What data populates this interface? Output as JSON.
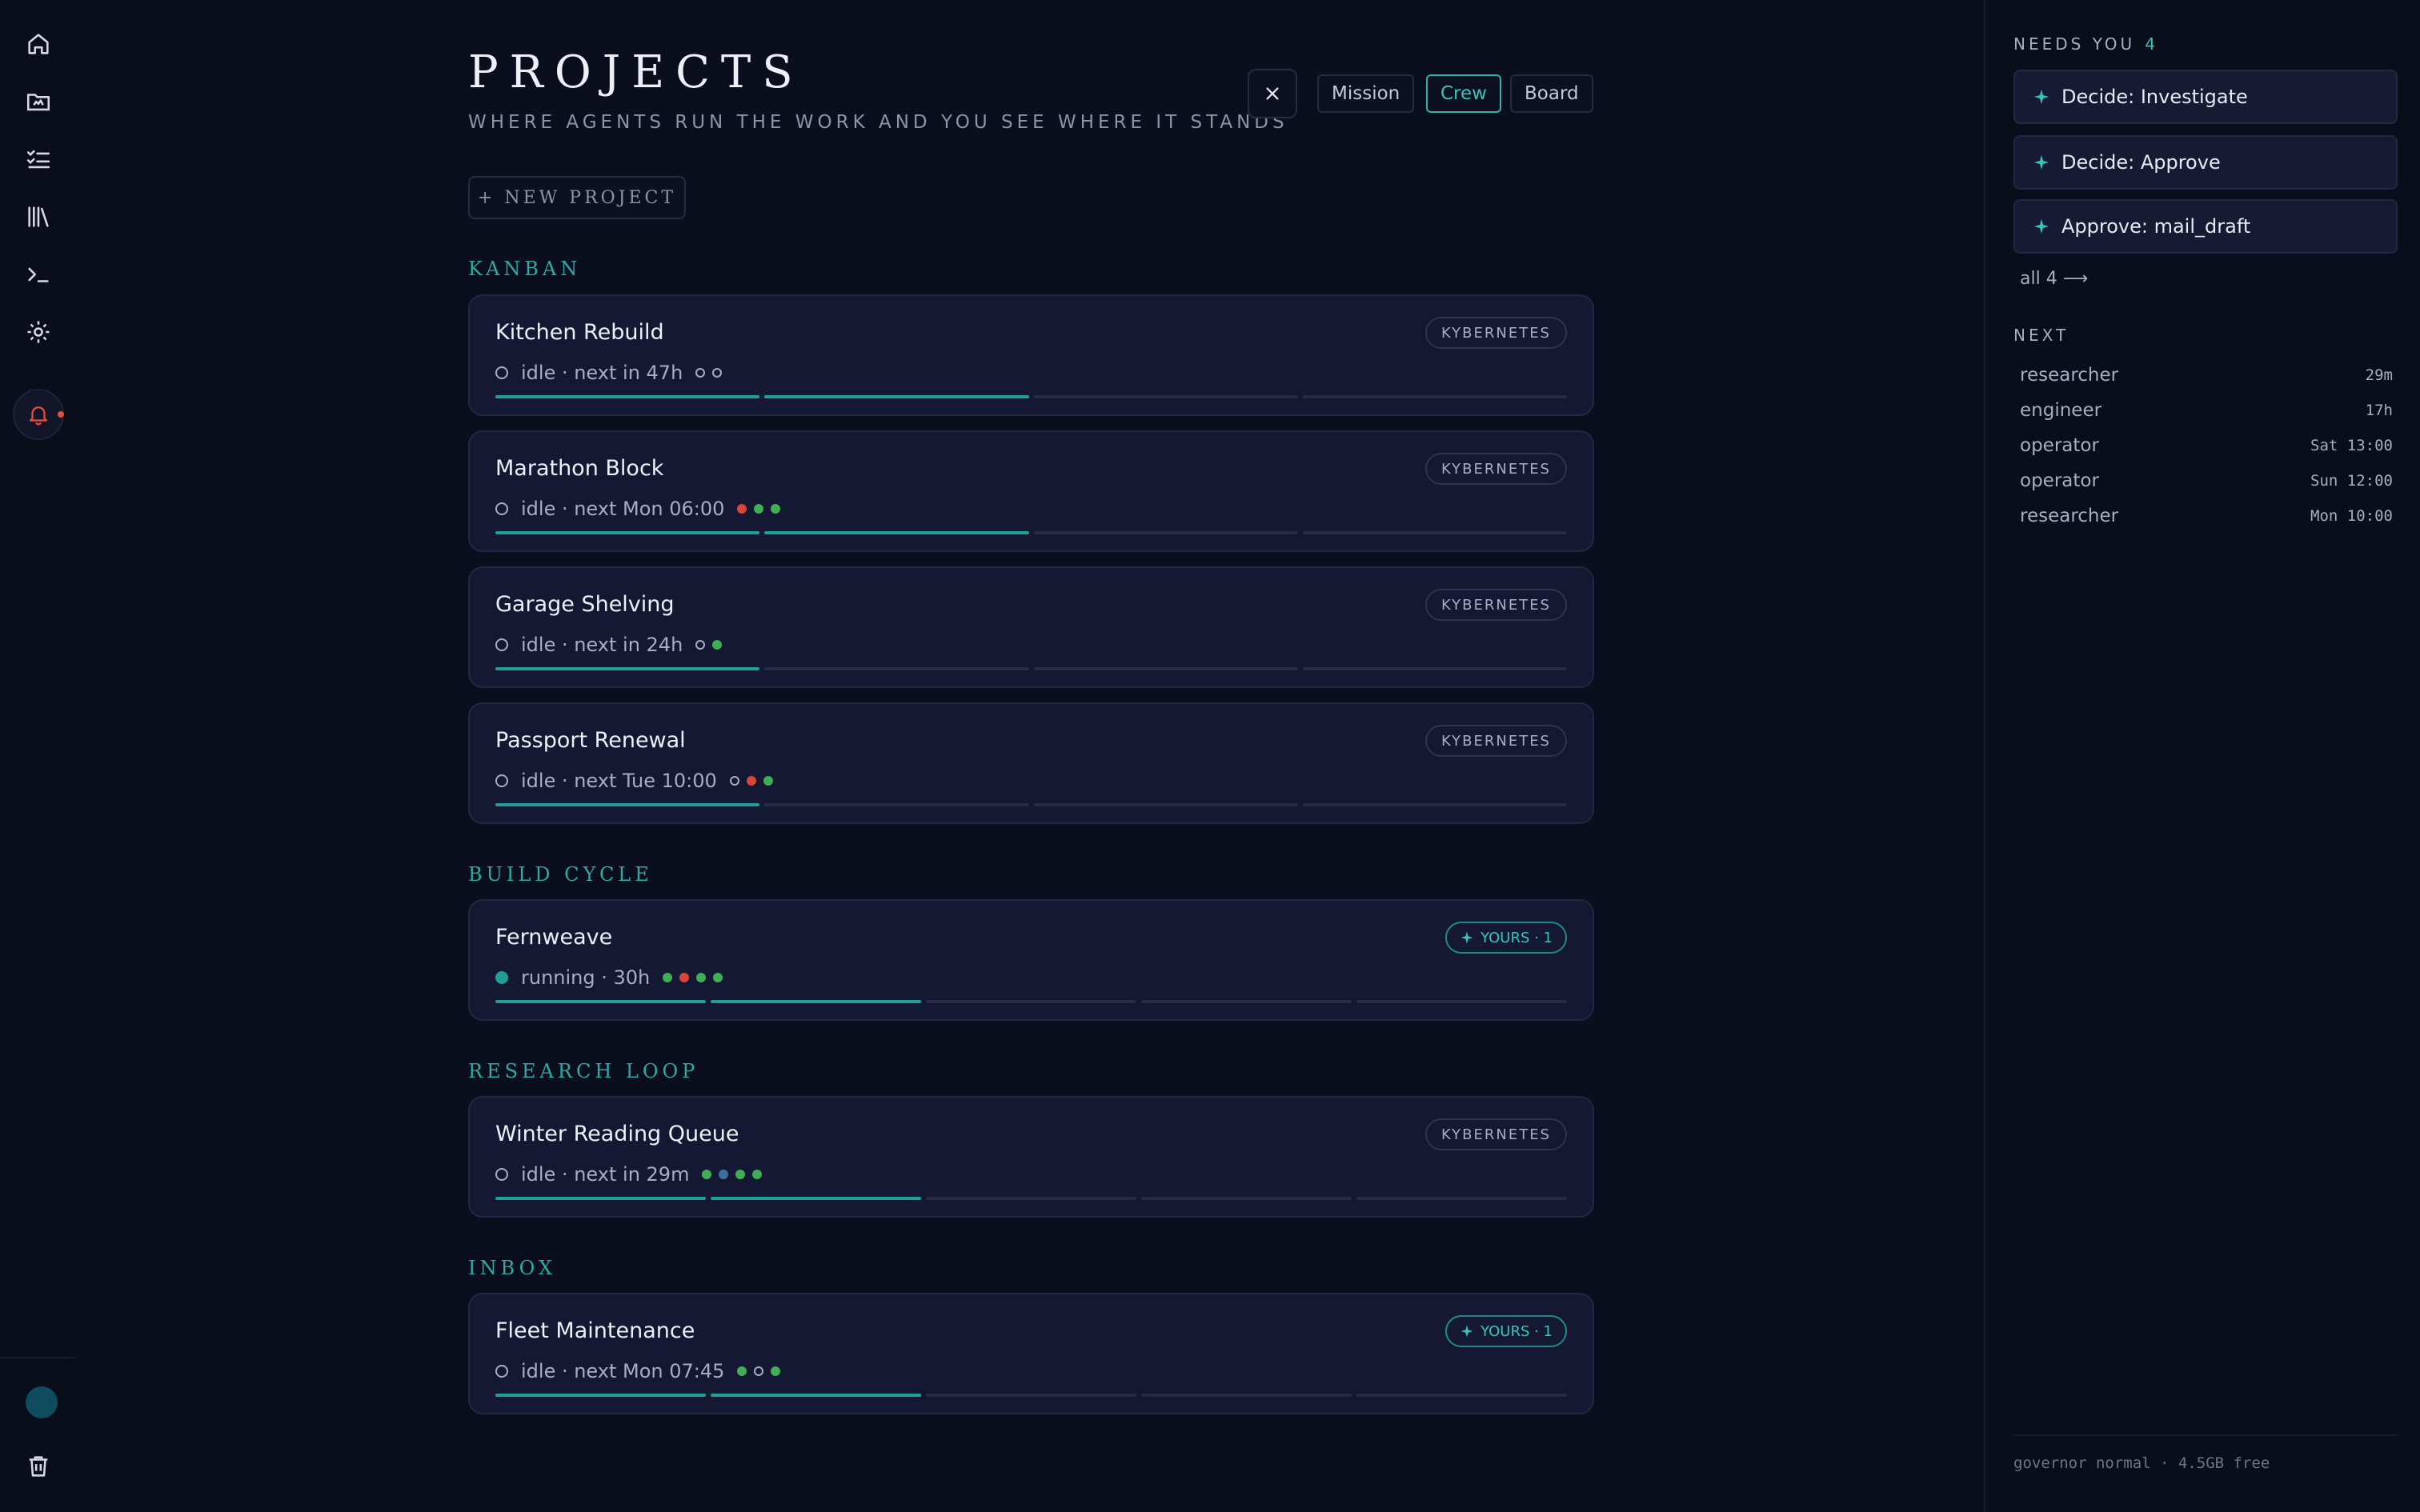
{
  "rail": {
    "items": [
      "home-icon",
      "folder-icon",
      "checklist-icon",
      "library-icon",
      "terminal-icon",
      "gear-icon"
    ],
    "alert_color": "#e2513f"
  },
  "header": {
    "title": "PROJECTS",
    "subtitle": "WHERE AGENTS RUN THE WORK AND YOU SEE WHERE IT STANDS",
    "views": [
      "Mission",
      "Crew",
      "Board"
    ],
    "active_view": "Crew",
    "new_project_label": "+ NEW PROJECT"
  },
  "colors": {
    "accent": "#2bb3ac",
    "background": "#0b0e1c",
    "card": "#141833",
    "ok": "#3fae55",
    "error": "#d9453b"
  },
  "sections": [
    {
      "label": "KANBAN",
      "projects": [
        {
          "name": "Kitchen Rebuild",
          "badge": "KYBERNETES",
          "status": "idle · next in 47h",
          "running": false,
          "dots": [
            "o",
            "o"
          ],
          "progress_done": 2,
          "progress_total": 4
        },
        {
          "name": "Marathon Block",
          "badge": "KYBERNETES",
          "status": "idle · next Mon 06:00",
          "running": false,
          "dots": [
            "r",
            "g",
            "g"
          ],
          "progress_done": 2,
          "progress_total": 4
        },
        {
          "name": "Garage Shelving",
          "badge": "KYBERNETES",
          "status": "idle · next in 24h",
          "running": false,
          "dots": [
            "o",
            "g"
          ],
          "progress_done": 1,
          "progress_total": 4
        },
        {
          "name": "Passport Renewal",
          "badge": "KYBERNETES",
          "status": "idle · next Tue 10:00",
          "running": false,
          "dots": [
            "o",
            "r",
            "g"
          ],
          "progress_done": 1,
          "progress_total": 4
        }
      ]
    },
    {
      "label": "BUILD CYCLE",
      "projects": [
        {
          "name": "Fernweave",
          "badge": "YOURS · 1",
          "badge_yours": true,
          "status": "running · 30h",
          "running": true,
          "dots": [
            "g",
            "r",
            "g",
            "g"
          ],
          "progress_done": 2,
          "progress_total": 5
        }
      ]
    },
    {
      "label": "RESEARCH LOOP",
      "projects": [
        {
          "name": "Winter Reading Queue",
          "badge": "KYBERNETES",
          "status": "idle · next in 29m",
          "running": false,
          "dots": [
            "g",
            "b",
            "g",
            "g"
          ],
          "progress_done": 2,
          "progress_total": 5
        }
      ]
    },
    {
      "label": "INBOX",
      "projects": [
        {
          "name": "Fleet Maintenance",
          "badge": "YOURS · 1",
          "badge_yours": true,
          "status": "idle · next Mon 07:45",
          "running": false,
          "dots": [
            "g",
            "o",
            "g"
          ],
          "progress_done": 2,
          "progress_total": 5
        }
      ]
    }
  ],
  "side": {
    "needs_title": "NEEDS YOU",
    "needs_count": "4",
    "asks": [
      "Decide: Investigate",
      "Decide: Approve",
      "Approve: mail_draft"
    ],
    "all_link": "all 4 ⟶",
    "next_title": "NEXT",
    "next": [
      {
        "role": "researcher",
        "when": "29m"
      },
      {
        "role": "engineer",
        "when": "17h"
      },
      {
        "role": "operator",
        "when": "Sat 13:00"
      },
      {
        "role": "operator",
        "when": "Sun 12:00"
      },
      {
        "role": "researcher",
        "when": "Mon 10:00"
      }
    ],
    "footer": "governor normal · 4.5GB free"
  }
}
